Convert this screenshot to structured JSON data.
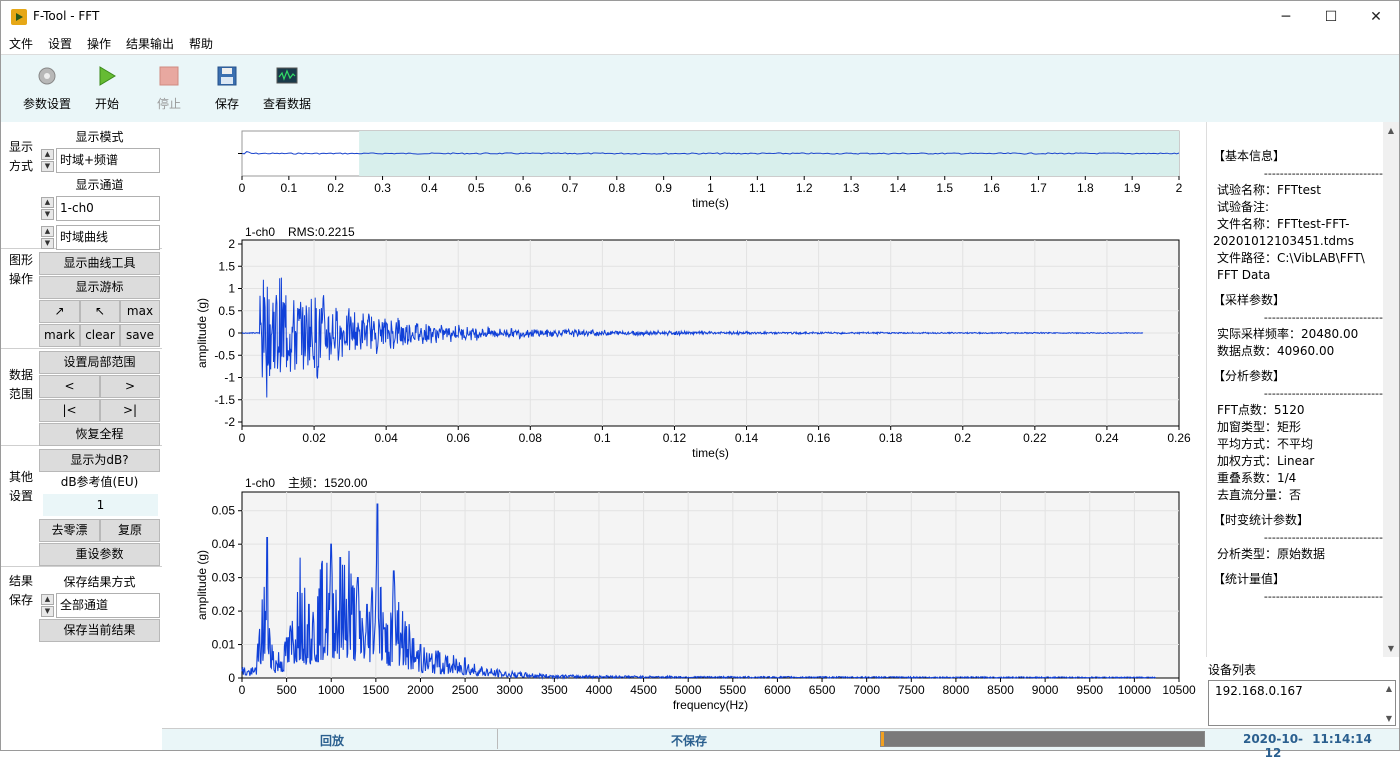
{
  "window": {
    "title": "F-Tool - FFT",
    "minimize": "─",
    "maximize": "☐",
    "close": "✕"
  },
  "menu": [
    "文件",
    "设置",
    "操作",
    "结果输出",
    "帮助"
  ],
  "toolbar": [
    {
      "label": "参数设置",
      "icon": "gear-icon",
      "enabled": true
    },
    {
      "label": "开始",
      "icon": "play-icon",
      "enabled": true
    },
    {
      "label": "停止",
      "icon": "stop-icon",
      "enabled": false
    },
    {
      "label": "保存",
      "icon": "floppy-icon",
      "enabled": true
    },
    {
      "label": "查看数据",
      "icon": "monitor-icon",
      "enabled": true
    }
  ],
  "left": {
    "display": {
      "group_label": "显示方式",
      "mode_caption": "显示模式",
      "mode_value": "时域+频谱",
      "channel_caption": "显示通道",
      "channel_value": "1-ch0",
      "curve_value": "时域曲线"
    },
    "graph": {
      "group_label": "图形操作",
      "tools_btn": "显示曲线工具",
      "cursor_btn": "显示游标",
      "b1": "↗",
      "b2": "↖",
      "b3": "max",
      "b4": "mark",
      "b5": "clear",
      "b6": "save"
    },
    "range": {
      "group_label": "数据范围",
      "local_btn": "设置局部范围",
      "prev": "<",
      "next": ">",
      "first": "|<",
      "last": ">|",
      "restore_btn": "恢复全程"
    },
    "other": {
      "group_label": "其他设置",
      "db_btn": "显示为dB?",
      "db_ref_caption": "dB参考值(EU)",
      "db_ref_value": "1",
      "zero_btn": "去零漂",
      "reset_btn": "复原",
      "reparam_btn": "重设参数"
    },
    "save": {
      "group_label": "结果保存",
      "mode_caption": "保存结果方式",
      "mode_value": "全部通道",
      "save_btn": "保存当前结果"
    }
  },
  "plots": {
    "overview": {
      "xlabel": "time(s)",
      "ticks": [
        "0",
        "0.1",
        "0.2",
        "0.3",
        "0.4",
        "0.5",
        "0.6",
        "0.7",
        "0.8",
        "0.9",
        "1",
        "1.1",
        "1.2",
        "1.3",
        "1.4",
        "1.5",
        "1.6",
        "1.7",
        "1.8",
        "1.9",
        "2"
      ]
    },
    "time": {
      "header_ch": "1-ch0",
      "header_info": "RMS:0.2215",
      "xlabel": "time(s)",
      "ylabel": "amplitude (g)",
      "xticks": [
        "0",
        "0.02",
        "0.04",
        "0.06",
        "0.08",
        "0.1",
        "0.12",
        "0.14",
        "0.16",
        "0.18",
        "0.2",
        "0.22",
        "0.24",
        "0.26"
      ],
      "yticks": [
        "2",
        "1.5",
        "1",
        "0.5",
        "0",
        "-0.5",
        "-1",
        "-1.5",
        "-2"
      ]
    },
    "freq": {
      "header_ch": "1-ch0",
      "header_info": "主频：1520.00",
      "xlabel": "frequency(Hz)",
      "ylabel": "amplitude (g)",
      "xticks": [
        "0",
        "500",
        "1000",
        "1500",
        "2000",
        "2500",
        "3000",
        "3500",
        "4000",
        "4500",
        "5000",
        "5500",
        "6000",
        "6500",
        "7000",
        "7500",
        "8000",
        "8500",
        "9000",
        "9500",
        "10000",
        "10500"
      ],
      "yticks": [
        "0.05",
        "0.04",
        "0.03",
        "0.02",
        "0.01",
        "0"
      ]
    }
  },
  "chart_data": [
    {
      "type": "line",
      "title": "",
      "xlabel": "time(s)",
      "ylabel": "",
      "xlim": [
        0,
        2
      ],
      "selection": [
        0.25,
        2.0
      ],
      "series": [
        {
          "values_note": "overview strip"
        }
      ]
    },
    {
      "type": "line",
      "title": "1-ch0 RMS:0.2215",
      "xlabel": "time(s)",
      "ylabel": "amplitude (g)",
      "xlim": [
        0,
        0.26
      ],
      "ylim": [
        -2,
        2
      ],
      "grid": true,
      "x": [
        0.005,
        0.006,
        0.008,
        0.01,
        0.012,
        0.015,
        0.018,
        0.02,
        0.025,
        0.03,
        0.04,
        0.05,
        0.06,
        0.08,
        0.1,
        0.12,
        0.15,
        0.2,
        0.25
      ],
      "series": [
        {
          "values": [
            1.9,
            -1.6,
            1.95,
            -1.5,
            1.5,
            -1.2,
            1.0,
            -1.5,
            0.8,
            -0.6,
            0.5,
            0.3,
            0.2,
            0.12,
            0.08,
            0.05,
            0.03,
            0.02,
            0.01
          ]
        }
      ]
    },
    {
      "type": "line",
      "title": "1-ch0 主频：1520.00",
      "xlabel": "frequency(Hz)",
      "ylabel": "amplitude (g)",
      "xlim": [
        0,
        10500
      ],
      "ylim": [
        0,
        0.055
      ],
      "grid": true,
      "x": [
        0,
        150,
        280,
        350,
        500,
        650,
        750,
        900,
        1000,
        1100,
        1200,
        1300,
        1400,
        1520,
        1600,
        1700,
        1800,
        2000,
        2200,
        2500,
        2800,
        3000,
        3500,
        4000,
        5000,
        10200
      ],
      "series": [
        {
          "values": [
            0.004,
            0.003,
            0.042,
            0.008,
            0.012,
            0.036,
            0.022,
            0.035,
            0.04,
            0.036,
            0.038,
            0.03,
            0.022,
            0.052,
            0.015,
            0.032,
            0.02,
            0.01,
            0.008,
            0.006,
            0.003,
            0.002,
            0.001,
            0.0008,
            0.0005,
            0.0003
          ]
        }
      ]
    }
  ],
  "right": {
    "sections": [
      {
        "head": "【基本信息】",
        "lines": [
          "试验名称：FFTtest",
          "试验备注:",
          "文件名称：FFTtest-FFT-",
          "20201012103451.tdms",
          "文件路径：C:\\VibLAB\\FFT\\",
          "FFT Data"
        ]
      },
      {
        "head": "【采样参数】",
        "lines": [
          "实际采样频率：20480.00",
          "数据点数：40960.00"
        ]
      },
      {
        "head": "【分析参数】",
        "lines": [
          "FFT点数：5120",
          "加窗类型：矩形",
          "平均方式：不平均",
          "加权方式：Linear",
          "重叠系数：1/4",
          "去直流分量：否"
        ]
      },
      {
        "head": "【时变统计参数】",
        "lines": [
          "分析类型：原始数据"
        ]
      },
      {
        "head": "【统计量值】",
        "lines": []
      }
    ],
    "dash": "------------------------------",
    "device_title": "设备列表",
    "device_items": [
      "192.168.0.167"
    ]
  },
  "status": {
    "mode": "回放",
    "save": "不保存",
    "progress": 0.01,
    "date": "2020-10-12",
    "time": "11:14:14"
  }
}
